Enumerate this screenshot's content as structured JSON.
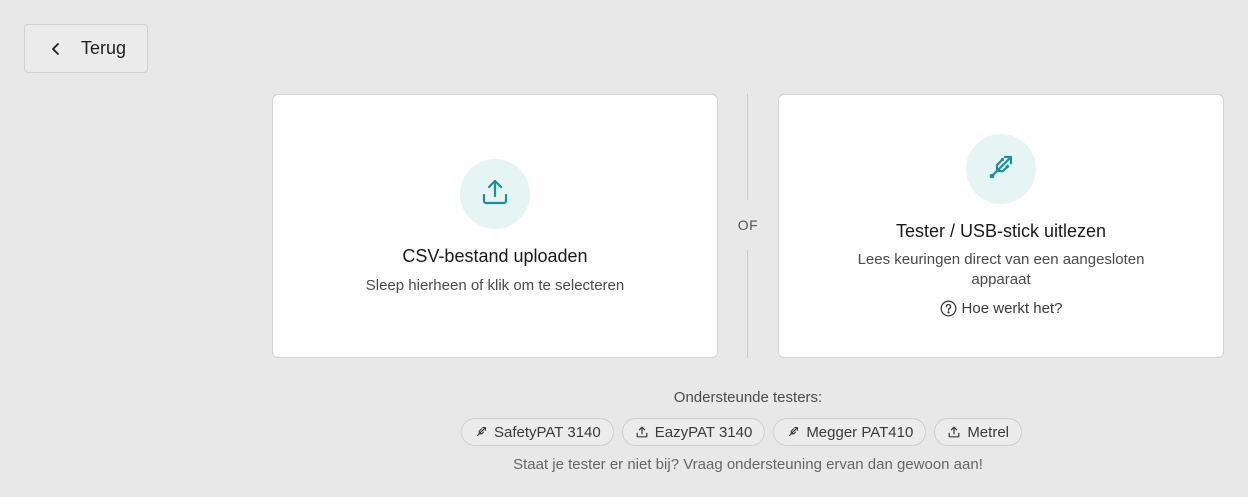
{
  "back_button": {
    "label": "Terug",
    "icon": "chevron-left-icon"
  },
  "upload_card": {
    "icon": "upload-icon",
    "title": "CSV-bestand uploaden",
    "description": "Sleep hierheen of klik om te selecteren"
  },
  "divider": {
    "label": "OF"
  },
  "usb_card": {
    "icon": "usb-icon",
    "title": "Tester / USB-stick uitlezen",
    "description": "Lees keuringen direct van een aangesloten apparaat",
    "help_label": "Hoe werkt het?",
    "help_icon": "question-circle-icon"
  },
  "supported": {
    "title": "Ondersteunde testers:",
    "testers": [
      {
        "label": "SafetyPAT 3140",
        "icon": "usb-icon"
      },
      {
        "label": "EazyPAT 3140",
        "icon": "upload-icon"
      },
      {
        "label": "Megger PAT410",
        "icon": "usb-icon"
      },
      {
        "label": "Metrel",
        "icon": "upload-icon"
      }
    ],
    "note": "Staat je tester er niet bij? Vraag ondersteuning ervan dan gewoon aan!"
  },
  "colors": {
    "accent": "#1a8f9a",
    "icon_bg": "#e6f4f4",
    "page_bg": "#e8e8e8"
  }
}
